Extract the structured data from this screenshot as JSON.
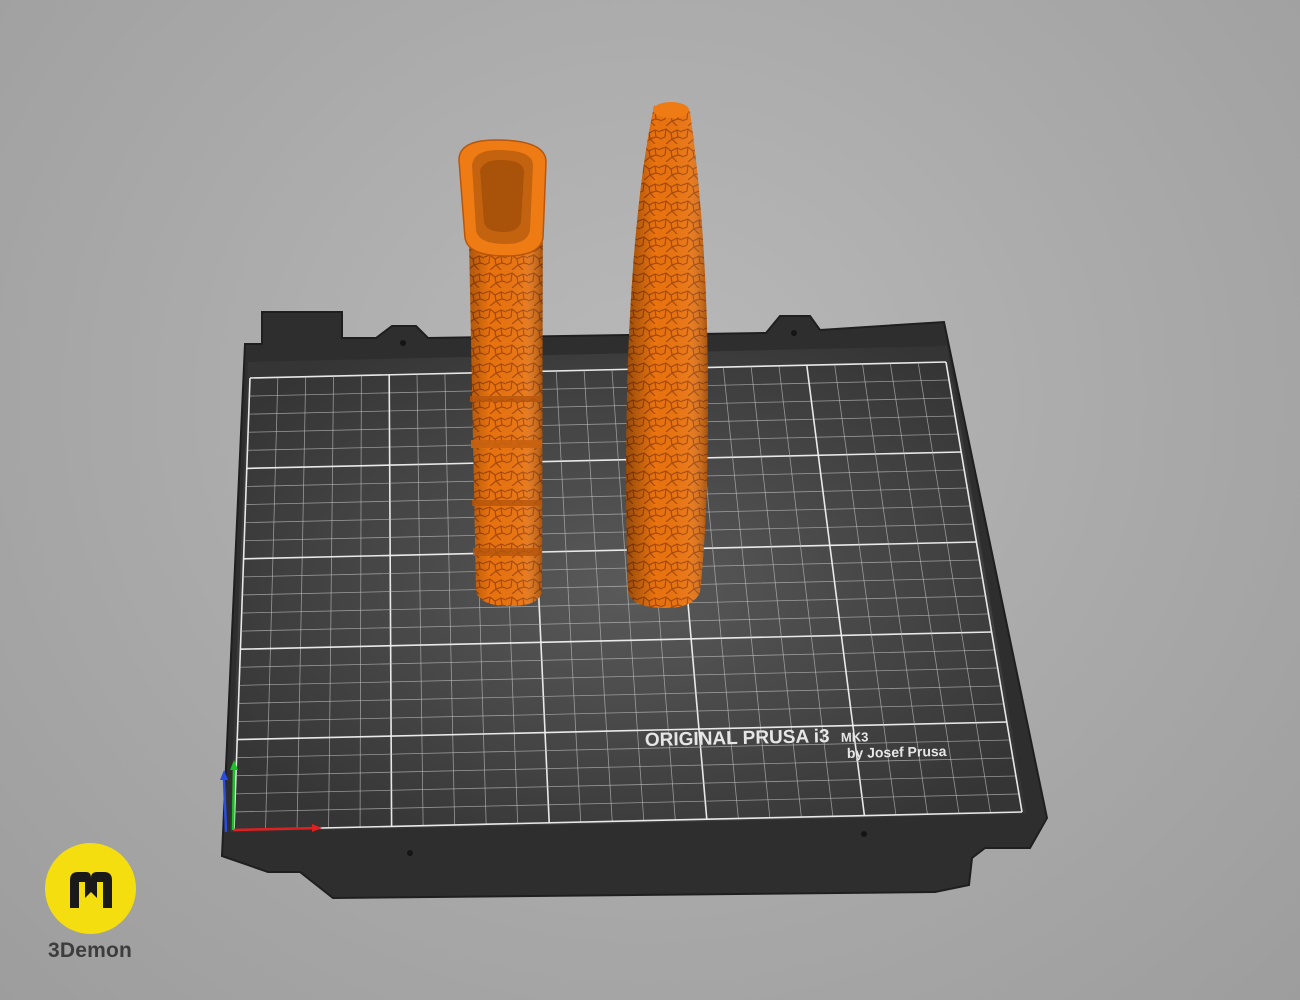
{
  "viewport": {
    "printer_bed": {
      "brand_line1": "ORIGINAL PRUSA i3",
      "brand_model": "MK3",
      "brand_line2": "by Josef Prusa"
    },
    "objects": [
      {
        "name": "hollow-handle-part",
        "color": "#e8730f"
      },
      {
        "name": "tapered-blade-part",
        "color": "#e8730f"
      }
    ],
    "axes_colors": {
      "x": "#e02020",
      "y": "#1fbf2a",
      "z": "#2a4de0"
    }
  },
  "watermark": {
    "label": "3Demon",
    "accent": "#f5de10"
  }
}
